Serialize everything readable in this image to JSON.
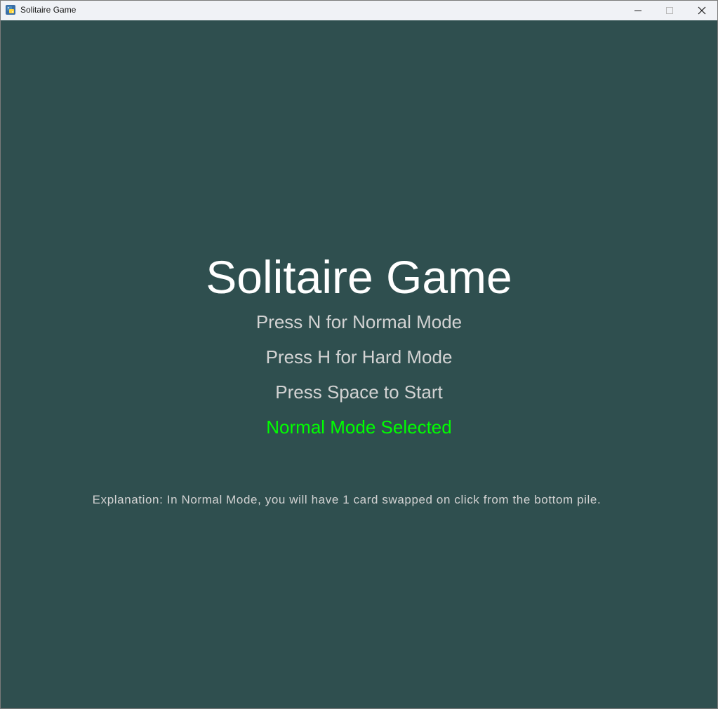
{
  "window": {
    "title": "Solitaire Game",
    "icon": "python-app-icon",
    "controls": {
      "minimize": "minimize-icon",
      "maximize": "maximize-icon",
      "close": "close-icon"
    }
  },
  "screen": {
    "title": "Solitaire Game",
    "options": {
      "normal": "Press N for Normal Mode",
      "hard": "Press H for Hard Mode",
      "start": "Press Space to Start"
    },
    "status": "Normal Mode Selected",
    "explanation": "Explanation: In Normal Mode, you will have 1 card swapped on click from the bottom pile."
  },
  "colors": {
    "background": "#2f4f4f",
    "title": "#ffffff",
    "text": "#d3d3d3",
    "selected": "#00ff00"
  }
}
